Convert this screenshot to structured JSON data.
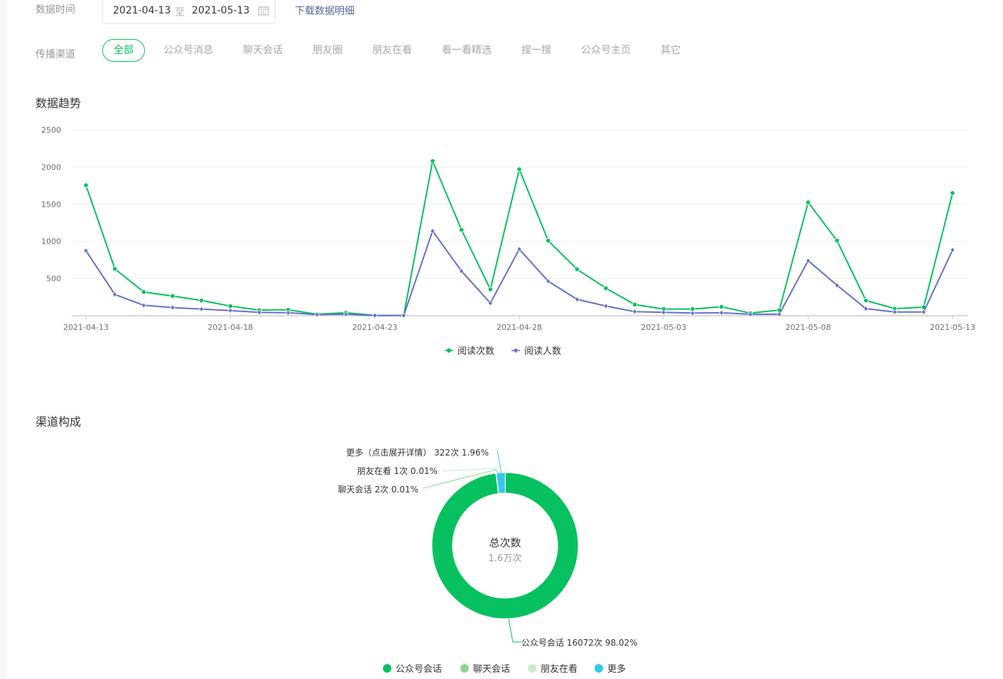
{
  "filters": {
    "date_label": "数据时间",
    "start_date": "2021-04-13",
    "range_sep": "至",
    "end_date": "2021-05-13",
    "download_label": "下载数据明细",
    "channel_label": "传播渠道",
    "channels": [
      "全部",
      "公众号消息",
      "聊天会话",
      "朋友圈",
      "朋友在看",
      "看一看精选",
      "搜一搜",
      "公众号主页",
      "其它"
    ],
    "active_channel": "全部"
  },
  "trend": {
    "title": "数据趋势"
  },
  "composition": {
    "title": "渠道构成",
    "center_title": "总次数",
    "center_value": "1.6万次",
    "labels": {
      "more": "更多（点击展开详情） 322次 1.96%",
      "pengyou": "朋友在看 1次 0.01%",
      "liaotian": "聊天会话 2次 0.01%",
      "gongzhonghao": "公众号会话 16072次 98.02%"
    },
    "legend": [
      "公众号会话",
      "聊天会话",
      "朋友在看",
      "更多"
    ]
  },
  "colors": {
    "green": "#07c160",
    "purple": "#6471c8",
    "light_green": "#8fd48f",
    "pale_green": "#c9eecf",
    "cyan": "#36c9e8",
    "link": "#576b95"
  },
  "chart_data": [
    {
      "type": "line",
      "title": "数据趋势",
      "x_labels": [
        "2021-04-13",
        "2021-04-18",
        "2021-04-23",
        "2021-04-28",
        "2021-05-03",
        "2021-05-08",
        "2021-05-13"
      ],
      "x": [
        "2021-04-13",
        "2021-04-14",
        "2021-04-15",
        "2021-04-16",
        "2021-04-17",
        "2021-04-18",
        "2021-04-19",
        "2021-04-20",
        "2021-04-21",
        "2021-04-22",
        "2021-04-23",
        "2021-04-24",
        "2021-04-25",
        "2021-04-26",
        "2021-04-27",
        "2021-04-28",
        "2021-04-29",
        "2021-04-30",
        "2021-05-01",
        "2021-05-02",
        "2021-05-03",
        "2021-05-04",
        "2021-05-05",
        "2021-05-06",
        "2021-05-07",
        "2021-05-08",
        "2021-05-09",
        "2021-05-10",
        "2021-05-11",
        "2021-05-12",
        "2021-05-13"
      ],
      "y_ticks": [
        500,
        1000,
        1500,
        2000,
        2500
      ],
      "ylim": [
        0,
        2500
      ],
      "grid": true,
      "legend_position": "bottom",
      "series": [
        {
          "name": "阅读次数",
          "color": "#07c160",
          "marker": "circle",
          "values": [
            1755,
            630,
            320,
            265,
            205,
            130,
            75,
            80,
            20,
            40,
            5,
            5,
            2080,
            1155,
            355,
            1970,
            1010,
            625,
            370,
            150,
            90,
            90,
            120,
            35,
            75,
            1525,
            1010,
            205,
            95,
            115,
            1650
          ]
        },
        {
          "name": "阅读人数",
          "color": "#6471c8",
          "marker": "diamond",
          "values": [
            875,
            285,
            140,
            110,
            90,
            70,
            45,
            40,
            15,
            20,
            3,
            3,
            1140,
            600,
            170,
            895,
            465,
            220,
            130,
            55,
            45,
            35,
            40,
            20,
            20,
            740,
            410,
            95,
            50,
            50,
            885
          ]
        }
      ]
    },
    {
      "type": "pie",
      "title": "渠道构成",
      "donut": true,
      "center_label": "总次数",
      "center_value": "1.6万次",
      "slices": [
        {
          "name": "公众号会话",
          "value": 16072,
          "percent": 98.02,
          "color": "#07c160"
        },
        {
          "name": "聊天会话",
          "value": 2,
          "percent": 0.01,
          "color": "#8fd48f"
        },
        {
          "name": "朋友在看",
          "value": 1,
          "percent": 0.01,
          "color": "#c9eecf"
        },
        {
          "name": "更多",
          "value": 322,
          "percent": 1.96,
          "color": "#36c9e8"
        }
      ]
    }
  ]
}
